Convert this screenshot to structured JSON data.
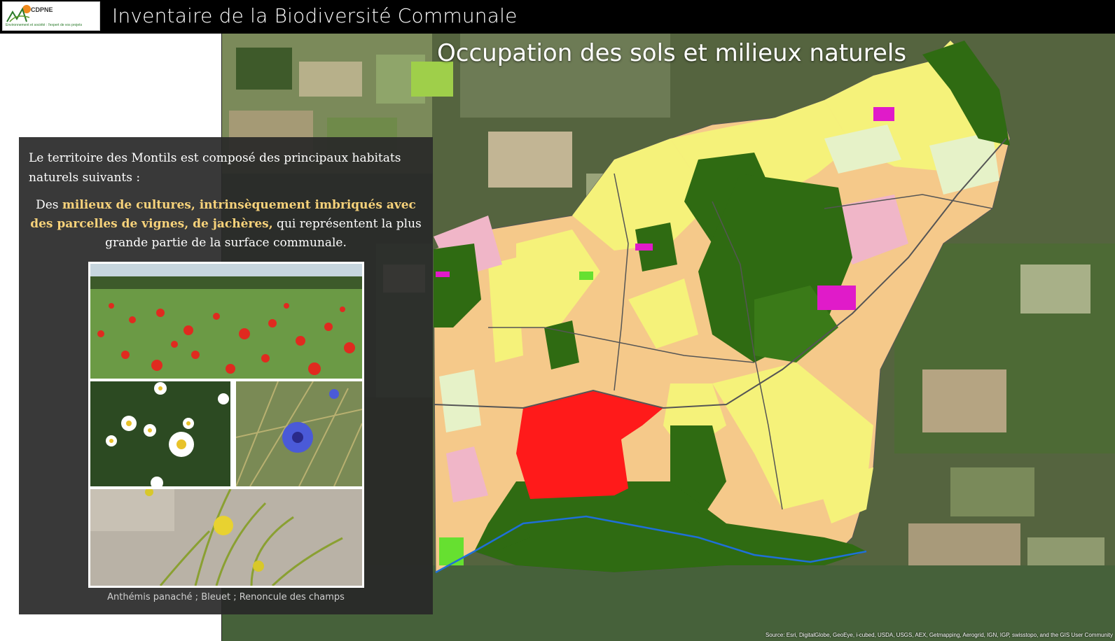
{
  "header": {
    "logo_name": "CDPNE",
    "logo_tagline": "Environnement et société : l'expert de vos projets",
    "title": "Inventaire de la Biodiversité Communale"
  },
  "map": {
    "title": "Occupation des sols et milieux naturels",
    "attribution": "Source: Esri, DigitalGlobe, GeoEye, i-cubed, USDA, USGS, AEX, Getmapping, Aerogrid, IGN, IGP, swisstopo, and the GIS User Community"
  },
  "panel": {
    "intro": "Le territoire des Montils est composé des principaux  habitats naturels suivants :",
    "para_pre": "Des ",
    "para_hl": "milieux de cultures, intrinsèquement imbriqués avec des parcelles de vignes, de jachères,",
    "para_post": " qui représentent la plus grande partie de la surface communale.",
    "caption": "Anthémis panaché ; Bleuet ; Renoncule des champs"
  },
  "colors": {
    "header_bg": "#000000",
    "highlight": "#f7d27a",
    "forest": "#2f6b12",
    "crop_yellow": "#f5f27a",
    "crop_orange": "#f5c98a",
    "urban_red": "#ff1a1a",
    "vine_pink": "#f0b6c8",
    "magenta": "#e01bc9"
  }
}
